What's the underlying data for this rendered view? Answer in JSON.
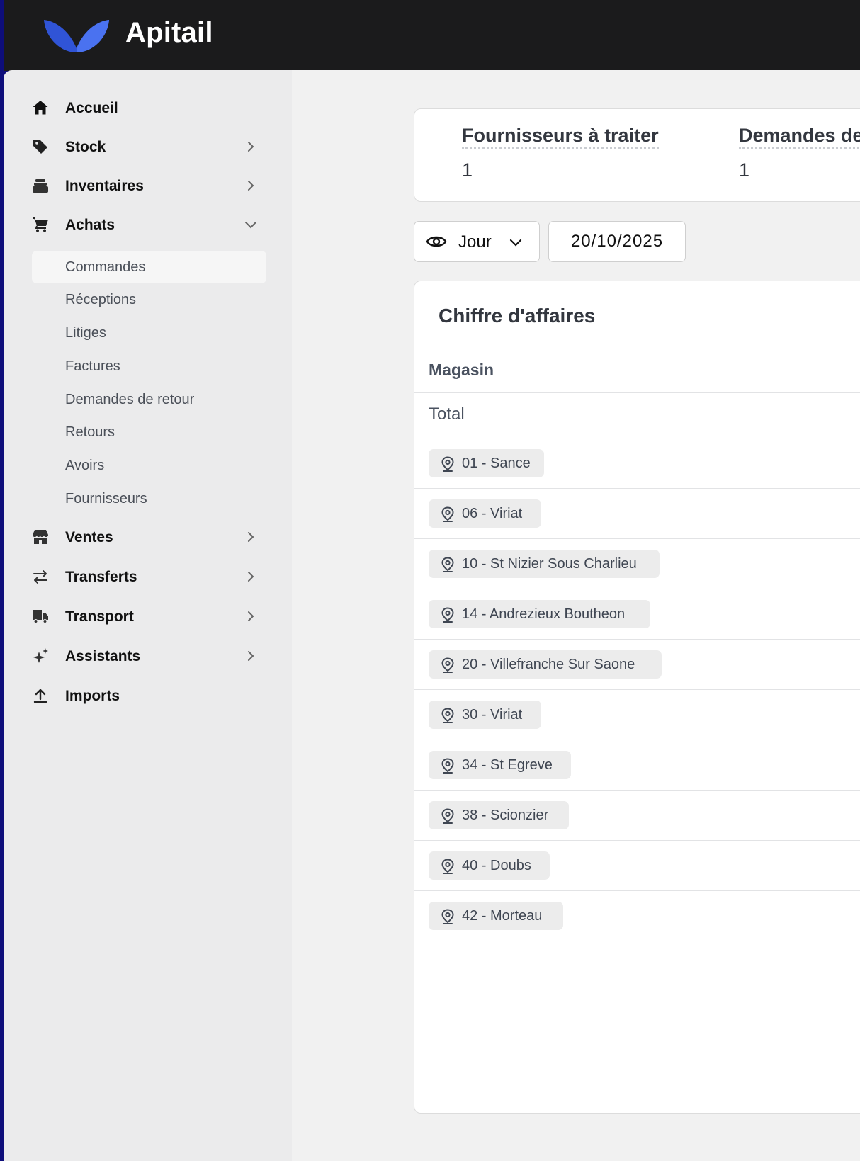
{
  "app": {
    "name": "Apitail"
  },
  "sidebar": {
    "items": [
      {
        "label": "Accueil",
        "icon": "home-icon"
      },
      {
        "label": "Stock",
        "icon": "tag-icon"
      },
      {
        "label": "Inventaires",
        "icon": "stack-icon"
      },
      {
        "label": "Achats",
        "icon": "cart-icon",
        "expanded": true,
        "children": [
          {
            "label": "Commandes",
            "active": true
          },
          {
            "label": "Réceptions"
          },
          {
            "label": "Litiges"
          },
          {
            "label": "Factures"
          },
          {
            "label": "Demandes de retour"
          },
          {
            "label": "Retours"
          },
          {
            "label": "Avoirs"
          },
          {
            "label": "Fournisseurs"
          }
        ]
      },
      {
        "label": "Ventes",
        "icon": "store-icon"
      },
      {
        "label": "Transferts",
        "icon": "transfer-arrows-icon"
      },
      {
        "label": "Transport",
        "icon": "truck-icon"
      },
      {
        "label": "Assistants",
        "icon": "sparkles-icon"
      },
      {
        "label": "Imports",
        "icon": "upload-icon"
      }
    ]
  },
  "stats": [
    {
      "title": "Fournisseurs à traiter",
      "value": "1"
    },
    {
      "title": "Demandes de",
      "value": "1"
    }
  ],
  "filters": {
    "view_label": "Jour",
    "date": "20/10/2025"
  },
  "table": {
    "title": "Chiffre d'affaires",
    "column_header": "Magasin",
    "total_label": "Total",
    "stores": [
      "01 - Sance",
      "06 - Viriat",
      "10 - St Nizier Sous Charlieu",
      "14 - Andrezieux Boutheon",
      "20 - Villefranche Sur Saone",
      "30 - Viriat",
      "34 - St Egreve",
      "38 - Scionzier",
      "40 - Doubs",
      "42 - Morteau"
    ]
  },
  "colors": {
    "brand_blue": "#3b5fe0",
    "topbar": "#1b1b1c",
    "sidebar_bg": "#ebebec",
    "main_bg": "#f1f1f1"
  }
}
